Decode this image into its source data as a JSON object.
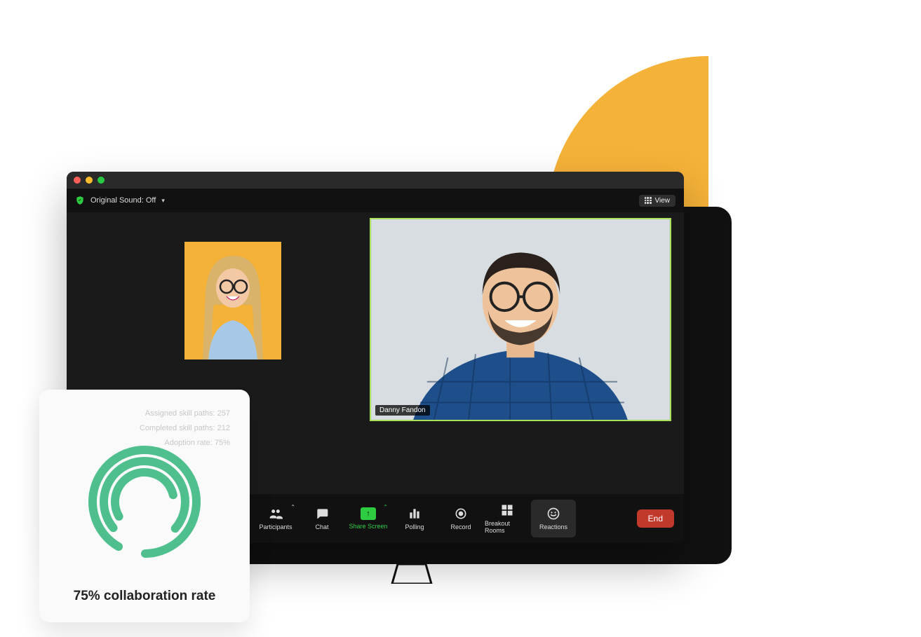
{
  "colors": {
    "accent_green": "#2ecc40",
    "brand_yellow": "#F5B238",
    "end_red": "#c0392b"
  },
  "zoom": {
    "sound_toggle": "Original Sound: Off",
    "view_button": "View",
    "speaker_name": "Danny Fandon",
    "toolbar": {
      "participants": "Participants",
      "chat": "Chat",
      "share": "Share Screen",
      "polling": "Polling",
      "record": "Record",
      "breakout": "Breakout Rooms",
      "reactions": "Reactions",
      "end": "End"
    }
  },
  "stats": {
    "line1": "Assigned skill paths: 257",
    "line2": "Completed skill paths: 212",
    "line3": "Adoption rate: 75%",
    "title": "75% collaboration rate"
  },
  "chart_data": {
    "type": "pie",
    "title": "75% collaboration rate",
    "series": [
      {
        "name": "Assigned skill paths",
        "value": 257,
        "pct": 100
      },
      {
        "name": "Completed skill paths",
        "value": 212,
        "pct": 82
      },
      {
        "name": "Adoption rate",
        "value": 75,
        "pct": 75
      }
    ],
    "xlabel": "",
    "ylabel": "",
    "ylim": [
      0,
      100
    ]
  }
}
